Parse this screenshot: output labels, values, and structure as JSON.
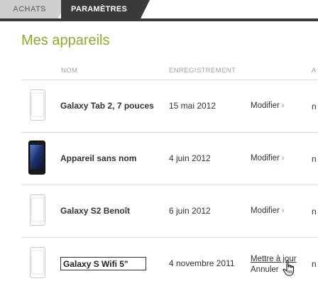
{
  "tabs": [
    {
      "label": "ACHATS",
      "active": false
    },
    {
      "label": "PARAMÈTRES",
      "active": true
    }
  ],
  "page_title": "Mes appareils",
  "columns": {
    "name": "NOM",
    "registration": "ENREGISTREMENT",
    "trailing": "A"
  },
  "devices": [
    {
      "name": "Galaxy Tab 2, 7 pouces",
      "date": "15 mai 2012",
      "action": "Modifier",
      "trailing": "n",
      "icon": "white-phone-icon"
    },
    {
      "name": "Appareil sans nom",
      "date": "4 juin 2012",
      "action": "Modifier",
      "trailing": "n",
      "icon": "black-phone-icon"
    },
    {
      "name": "Galaxy S2 Benoît",
      "date": "6 juin 2012",
      "action": "Modifier",
      "trailing": "n",
      "icon": "white-phone-icon"
    },
    {
      "name_input_value": "Galaxy S Wifi 5\"",
      "date": "4 novembre 2011",
      "update_label": "Mettre à jour",
      "cancel_label": "Annuler",
      "trailing": "n",
      "icon": "white-phone-icon"
    }
  ],
  "chevron": "›",
  "colors": {
    "title_green": "#8dac2e",
    "tab_dark": "#3a3a3a",
    "tab_inactive": "#cfcfcf",
    "link_chevron": "#5b8fc7",
    "separator": "#dddddd"
  }
}
